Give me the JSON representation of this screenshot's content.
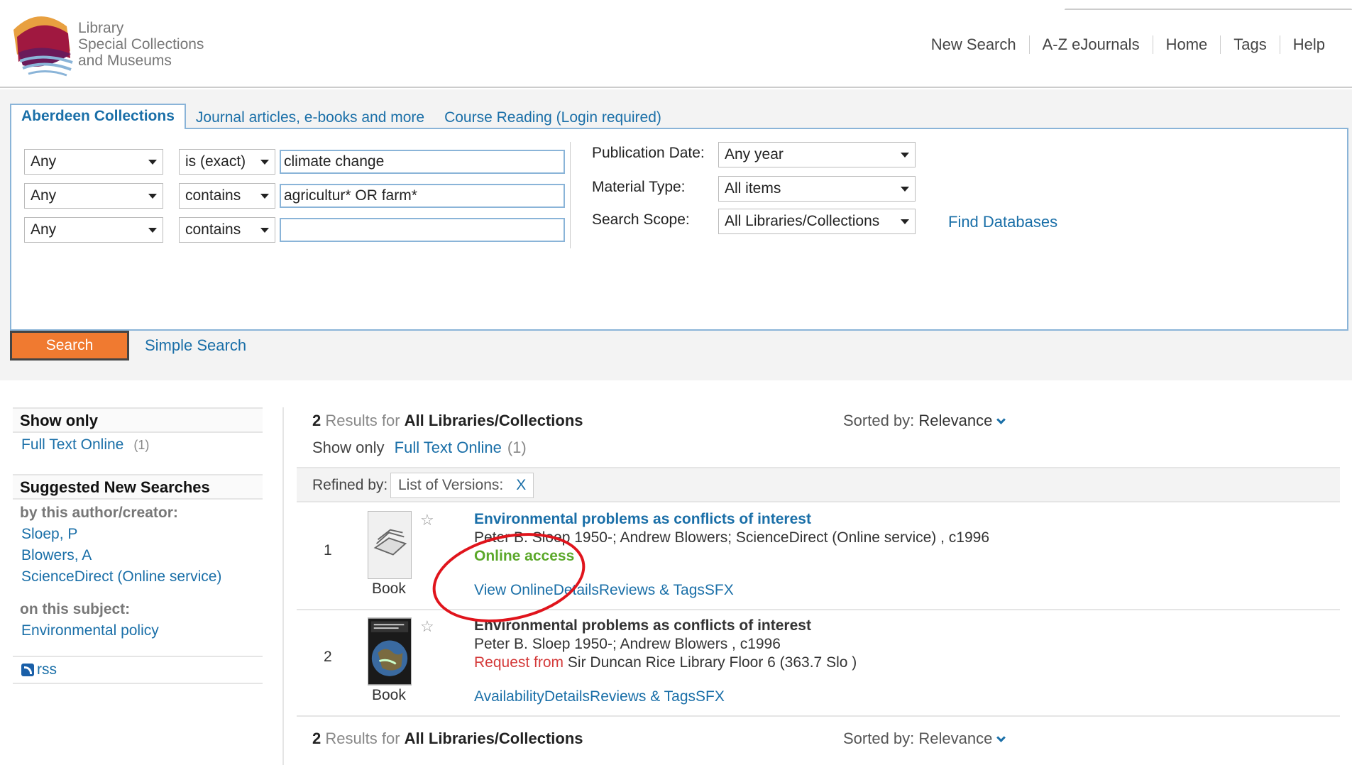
{
  "header": {
    "logo_lines": [
      "Library",
      "Special Collections",
      "and Museums"
    ],
    "nav": [
      "New Search",
      "A-Z eJournals",
      "Home",
      "Tags",
      "Help"
    ]
  },
  "tabs": [
    "Aberdeen Collections",
    "Journal articles, e-books and more",
    "Course Reading (Login required)"
  ],
  "advanced_search": {
    "rows": [
      {
        "field": "Any",
        "operator": "is (exact)",
        "value": "climate change"
      },
      {
        "field": "Any",
        "operator": "contains",
        "value": "agricultur* OR farm*"
      },
      {
        "field": "Any",
        "operator": "contains",
        "value": ""
      }
    ],
    "filters": [
      {
        "label": "Publication Date:",
        "value": "Any year"
      },
      {
        "label": "Material Type:",
        "value": "All items"
      },
      {
        "label": "Search Scope:",
        "value": "All Libraries/Collections"
      }
    ],
    "find_databases": "Find Databases",
    "search_button": "Search",
    "simple_search": "Simple Search"
  },
  "sidebar": {
    "show_only_title": "Show only",
    "show_only_item": "Full Text Online",
    "show_only_count": "(1)",
    "suggested_title": "Suggested New Searches",
    "by_author_label": "by this author/creator:",
    "authors": [
      "Sloep, P",
      "Blowers, A",
      "ScienceDirect (Online service)"
    ],
    "on_subject_label": "on this subject:",
    "subjects": [
      "Environmental policy"
    ],
    "rss": "rss"
  },
  "results": {
    "count": "2",
    "results_for": "Results for",
    "scope": "All Libraries/Collections",
    "sorted_by_label": "Sorted by:",
    "sorted_by_value": "Relevance",
    "show_only_label": "Show only",
    "show_only_link": "Full Text Online",
    "show_only_count": "(1)",
    "refined_label": "Refined by:",
    "refined_chip": "List of Versions:",
    "refined_remove": "X",
    "items": [
      {
        "num": "1",
        "type": "Book",
        "title": "Environmental problems as conflicts of interest",
        "authors": "Peter B. Sloep 1950-; Andrew Blowers; ScienceDirect (Online service) , c1996",
        "status": "Online access",
        "actions": [
          "View Online",
          "Details",
          "Reviews & Tags",
          "SFX"
        ]
      },
      {
        "num": "2",
        "type": "Book",
        "title": "Environmental problems as conflicts of interest",
        "authors": "Peter B. Sloep 1950-; Andrew Blowers , c1996",
        "status_prefix": "Request from",
        "status_location": "Sir Duncan Rice Library Floor 6 (363.7 Slo )",
        "actions": [
          "Availability",
          "Details",
          "Reviews & Tags",
          "SFX"
        ]
      }
    ]
  },
  "colors": {
    "link": "#1a6fa8",
    "search_button": "#f07a30",
    "online_access": "#5ba82a",
    "request": "#d43a3a",
    "annotation_circle": "#e0141c"
  }
}
